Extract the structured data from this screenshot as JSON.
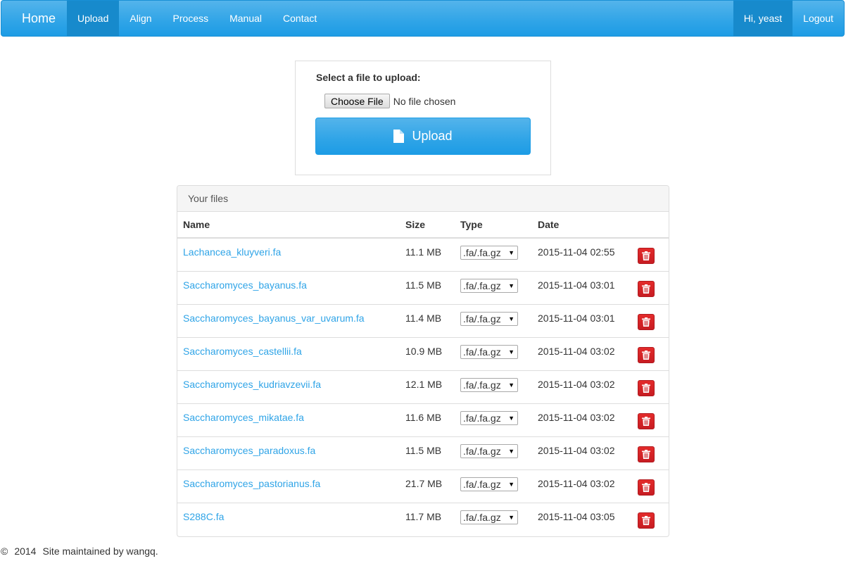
{
  "nav": {
    "brand": "Home",
    "items": [
      {
        "label": "Upload"
      },
      {
        "label": "Align"
      },
      {
        "label": "Process"
      },
      {
        "label": "Manual"
      },
      {
        "label": "Contact"
      }
    ],
    "user": "Hi, yeast",
    "logout": "Logout"
  },
  "upload": {
    "label": "Select a file to upload:",
    "choose_button": "Choose File",
    "no_file": "No file chosen",
    "button_label": "Upload",
    "button_icon": "file-icon"
  },
  "files": {
    "heading": "Your files",
    "columns": [
      "Name",
      "Size",
      "Type",
      "Date"
    ],
    "rows": [
      {
        "name": "Lachancea_kluyveri.fa",
        "size": "11.1 MB",
        "type": ".fa/.fa.gz",
        "date": "2015-11-04 02:55"
      },
      {
        "name": "Saccharomyces_bayanus.fa",
        "size": "11.5 MB",
        "type": ".fa/.fa.gz",
        "date": "2015-11-04 03:01"
      },
      {
        "name": "Saccharomyces_bayanus_var_uvarum.fa",
        "size": "11.4 MB",
        "type": ".fa/.fa.gz",
        "date": "2015-11-04 03:01"
      },
      {
        "name": "Saccharomyces_castellii.fa",
        "size": "10.9 MB",
        "type": ".fa/.fa.gz",
        "date": "2015-11-04 03:02"
      },
      {
        "name": "Saccharomyces_kudriavzevii.fa",
        "size": "12.1 MB",
        "type": ".fa/.fa.gz",
        "date": "2015-11-04 03:02"
      },
      {
        "name": "Saccharomyces_mikatae.fa",
        "size": "11.6 MB",
        "type": ".fa/.fa.gz",
        "date": "2015-11-04 03:02"
      },
      {
        "name": "Saccharomyces_paradoxus.fa",
        "size": "11.5 MB",
        "type": ".fa/.fa.gz",
        "date": "2015-11-04 03:02"
      },
      {
        "name": "Saccharomyces_pastorianus.fa",
        "size": "21.7 MB",
        "type": ".fa/.fa.gz",
        "date": "2015-11-04 03:02"
      },
      {
        "name": "S288C.fa",
        "size": "11.7 MB",
        "type": ".fa/.fa.gz",
        "date": "2015-11-04 03:05"
      }
    ]
  },
  "footer": {
    "copyright": "©",
    "year": "2014",
    "text": "Site maintained by wangq."
  },
  "colors": {
    "brand": "#2fa4e7",
    "active_nav": "#178acc",
    "danger": "#c71c22",
    "link": "#2fa4e7"
  }
}
